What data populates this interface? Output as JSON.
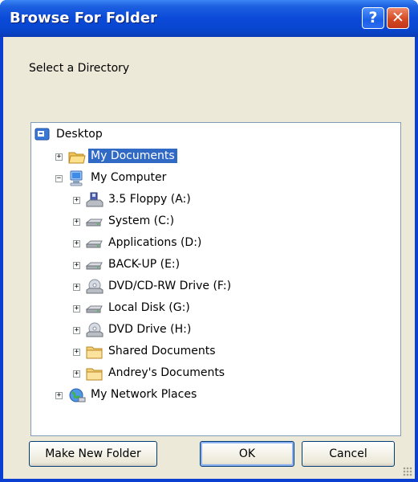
{
  "window": {
    "title": "Browse For Folder",
    "help_glyph": "?",
    "close_glyph": "✕"
  },
  "prompt": "Select a Directory",
  "tree": [
    {
      "label": "Desktop",
      "level": 0,
      "icon": "desktop-icon",
      "expander": "",
      "selected": false
    },
    {
      "label": "My Documents",
      "level": 1,
      "icon": "folder-open-icon",
      "expander": "+",
      "selected": true
    },
    {
      "label": "My Computer",
      "level": 1,
      "icon": "computer-icon",
      "expander": "−",
      "selected": false
    },
    {
      "label": "3.5 Floppy (A:)",
      "level": 2,
      "icon": "floppy-drive-icon",
      "expander": "+",
      "selected": false
    },
    {
      "label": "System (C:)",
      "level": 2,
      "icon": "hard-drive-icon",
      "expander": "+",
      "selected": false
    },
    {
      "label": "Applications (D:)",
      "level": 2,
      "icon": "hard-drive-icon",
      "expander": "+",
      "selected": false
    },
    {
      "label": "BACK-UP (E:)",
      "level": 2,
      "icon": "hard-drive-icon",
      "expander": "+",
      "selected": false
    },
    {
      "label": "DVD/CD-RW Drive (F:)",
      "level": 2,
      "icon": "cd-drive-icon",
      "expander": "+",
      "selected": false
    },
    {
      "label": "Local Disk (G:)",
      "level": 2,
      "icon": "hard-drive-icon",
      "expander": "+",
      "selected": false
    },
    {
      "label": "DVD Drive (H:)",
      "level": 2,
      "icon": "cd-drive-icon",
      "expander": "+",
      "selected": false
    },
    {
      "label": "Shared Documents",
      "level": 2,
      "icon": "folder-icon",
      "expander": "+",
      "selected": false
    },
    {
      "label": "Andrey's Documents",
      "level": 2,
      "icon": "folder-icon",
      "expander": "+",
      "selected": false
    },
    {
      "label": "My Network Places",
      "level": 1,
      "icon": "network-places-icon",
      "expander": "+",
      "selected": false
    }
  ],
  "buttons": {
    "make_new_folder": "Make New Folder",
    "ok": "OK",
    "cancel": "Cancel"
  },
  "colors": {
    "title_bar": "#0b4ad8",
    "selection": "#316ac5",
    "dialog_face": "#ece9d8"
  }
}
